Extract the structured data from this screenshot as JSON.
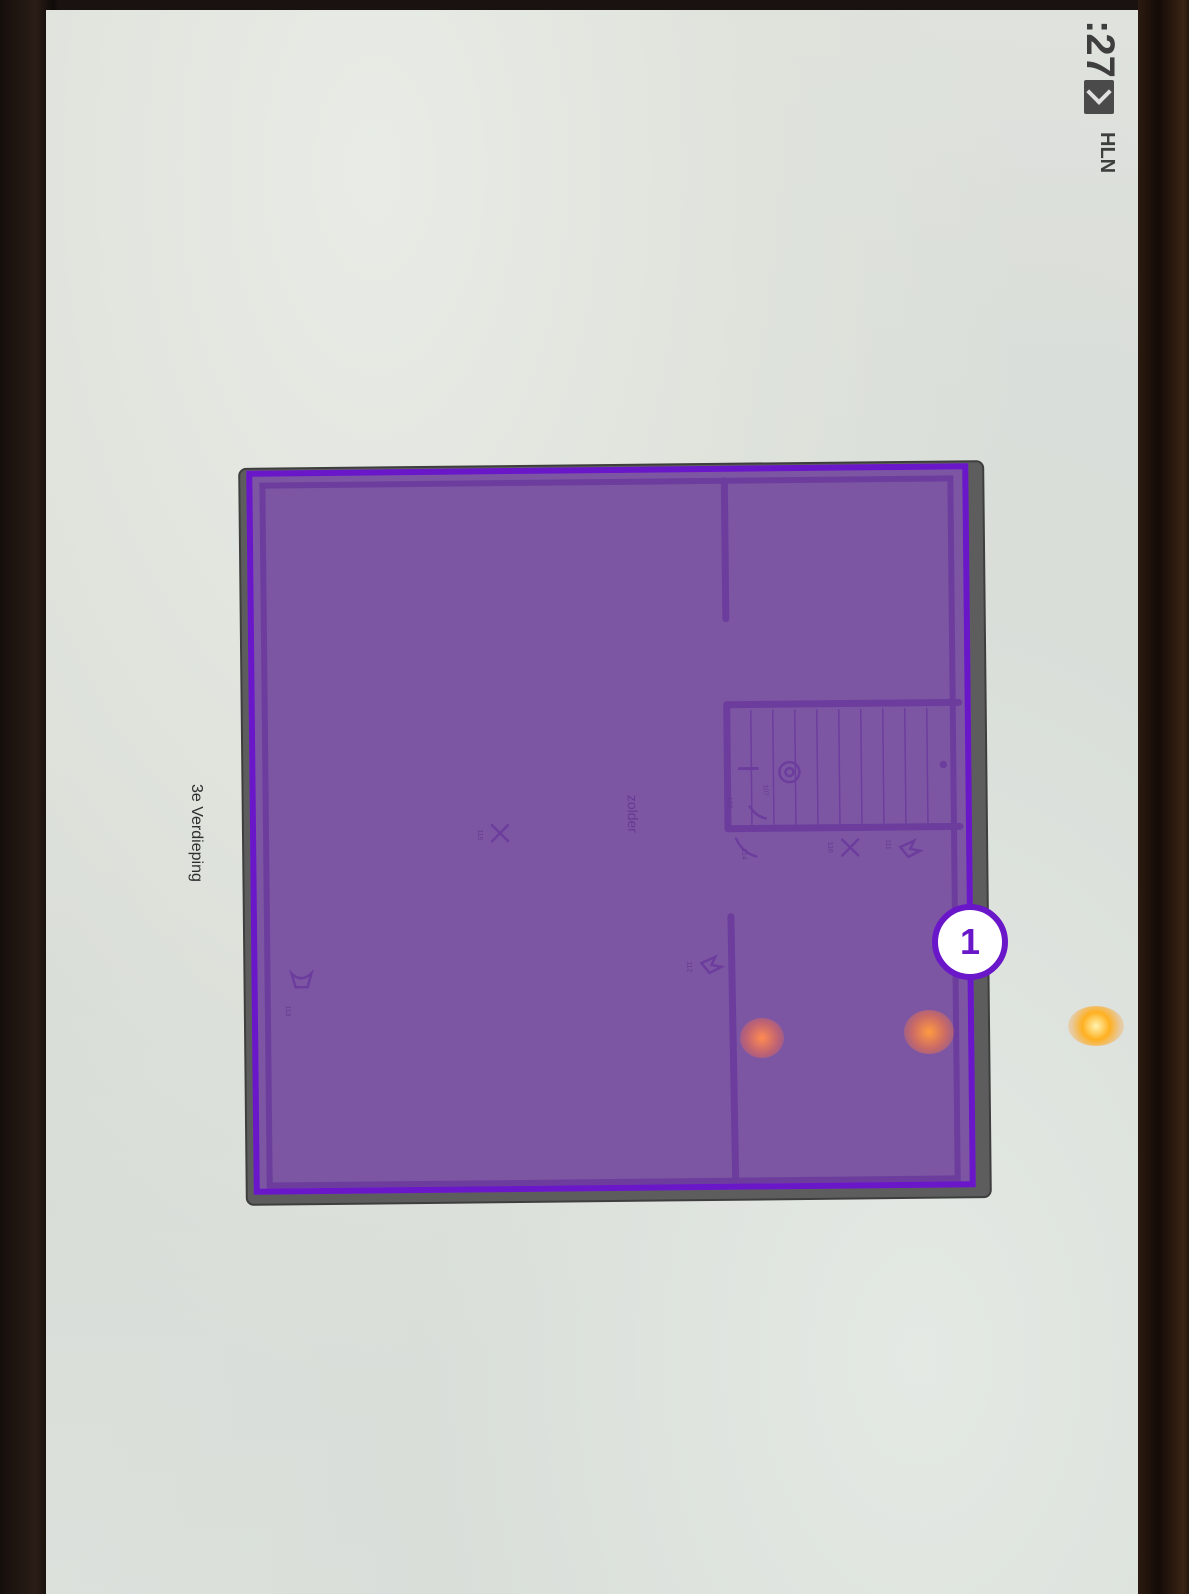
{
  "status_bar": {
    "time_fragment": ":27",
    "mail_icon": "mail-icon",
    "app_label": "HLN"
  },
  "page": {
    "title": "3e Verdieping"
  },
  "floorplan": {
    "room_label": "zolder",
    "fixture_labels": [
      "115",
      "116",
      "111",
      "112",
      "113",
      "114",
      "107",
      "108"
    ]
  },
  "annotation": {
    "badge_number": "1",
    "highlight_color": "#6a16c9"
  }
}
